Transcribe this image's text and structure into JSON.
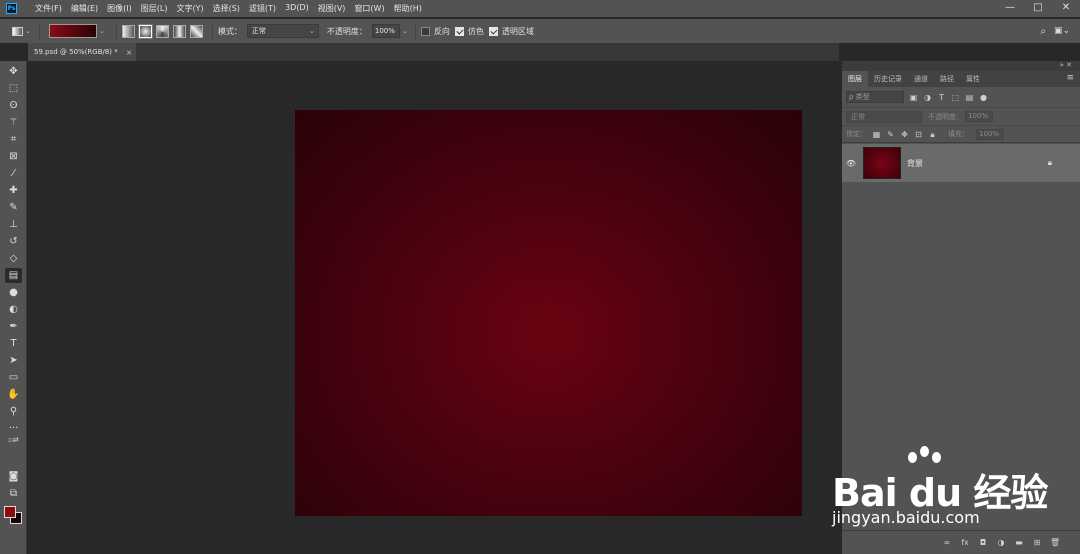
{
  "app": {
    "logo": "Ps"
  },
  "menu": [
    "文件(F)",
    "编辑(E)",
    "图像(I)",
    "图层(L)",
    "文字(Y)",
    "选择(S)",
    "滤镜(T)",
    "3D(D)",
    "视图(V)",
    "窗口(W)",
    "帮助(H)"
  ],
  "window_controls": {
    "minimize": "—",
    "maximize": "□",
    "close": "✕"
  },
  "options": {
    "mode_label": "模式：",
    "mode_value": "正常",
    "opacity_label": "不透明度：",
    "opacity_value": "100%",
    "reverse_label": "反向",
    "reverse_checked": false,
    "dither_label": "仿色",
    "dither_checked": true,
    "transparency_label": "透明区域",
    "transparency_checked": true,
    "gradient_colors": [
      "#8b0a16",
      "#2a0305"
    ]
  },
  "document_tab": {
    "title": "59.psd @ 50%(RGB/8) *",
    "close": "×"
  },
  "tools": [
    "move-icon",
    "marquee-icon",
    "lasso-icon",
    "magic-wand-icon",
    "crop-icon",
    "frame-icon",
    "eyedropper-icon",
    "healing-brush-icon",
    "brush-icon",
    "clone-stamp-icon",
    "history-brush-icon",
    "eraser-icon",
    "gradient-icon",
    "blur-icon",
    "dodge-icon",
    "pen-icon",
    "type-icon",
    "path-selection-icon",
    "rectangle-icon",
    "hand-icon",
    "zoom-icon",
    "more-tools-icon"
  ],
  "colors": {
    "foreground": "#8b0a14",
    "background": "#1a0204",
    "canvas_center": "#6a0311",
    "canvas_edge": "#2a0208"
  },
  "panel": {
    "tabs": [
      "图层",
      "历史记录",
      "通道",
      "路径",
      "属性"
    ],
    "active_tab": "图层",
    "filter_label": "ρ 类型",
    "blend_mode": "正常",
    "opacity_label": "不透明度：",
    "opacity_value": "100%",
    "lock_label": "锁定：",
    "fill_label": "填充：",
    "fill_value": "100%",
    "layers": [
      {
        "name": "背景",
        "visible": true,
        "locked": true
      }
    ]
  },
  "watermark": {
    "logo_text": "Bai du 经验",
    "subtitle": "jingyan.baidu.com"
  }
}
